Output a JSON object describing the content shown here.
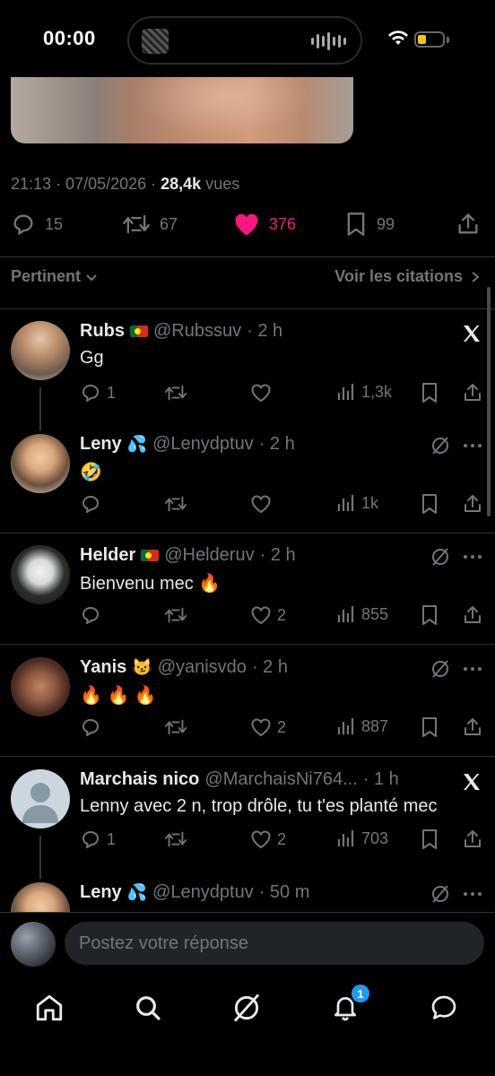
{
  "status_bar": {
    "time": "00:00"
  },
  "tweet": {
    "time": "21:13",
    "date": "07/05/2026",
    "views": "28,4k",
    "views_label": "vues",
    "replies": "15",
    "reposts": "67",
    "likes": "376",
    "bookmarks": "99"
  },
  "sort": {
    "label": "Pertinent",
    "quotes_label": "Voir les citations"
  },
  "replies": [
    {
      "name": "Rubs",
      "handle": "@Rubssuv",
      "time": "· 2 h",
      "text": "Gg",
      "replies": "1",
      "likes": "",
      "views": "1,3k",
      "corner": "x-logo"
    },
    {
      "name": "Leny",
      "handle": "@Lenydptuv",
      "time": "· 2 h",
      "text": "🤣",
      "replies": "",
      "likes": "",
      "views": "1k",
      "corner": "grok-more"
    },
    {
      "name": "Helder",
      "handle": "@Helderuv",
      "time": "· 2 h",
      "text": "Bienvenu mec 🔥",
      "replies": "",
      "likes": "2",
      "views": "855",
      "corner": "grok-more"
    },
    {
      "name": "Yanis",
      "handle": "@yanisvdo",
      "time": "· 2 h",
      "text": "🔥 🔥 🔥",
      "replies": "",
      "likes": "2",
      "views": "887",
      "corner": "grok-more"
    },
    {
      "name": "Marchais nico",
      "handle": "@MarchaisNi764...",
      "time": "· 1 h",
      "text": "Lenny avec 2 n, trop drôle, tu t'es planté mec",
      "replies": "1",
      "likes": "2",
      "views": "703",
      "corner": "x-logo"
    },
    {
      "name": "Leny",
      "handle": "@Lenydptuv",
      "time": "· 50 m",
      "text": "",
      "replies": "",
      "likes": "",
      "views": "",
      "corner": "grok-more"
    }
  ],
  "composer": {
    "placeholder": "Postez votre réponse"
  },
  "tabs": {
    "notifications_badge": "1"
  }
}
